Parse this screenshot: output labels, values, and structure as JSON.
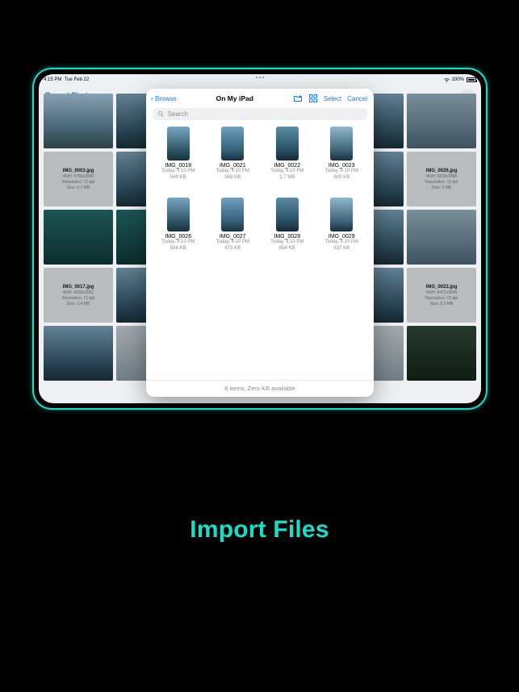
{
  "statusbar": {
    "time": "4:15 PM",
    "date": "Tue Feb 22",
    "battery": "100%"
  },
  "app": {
    "recent_label": "Recent Photos"
  },
  "backdrop": {
    "left_info": {
      "name": "IMG_0003.jpg",
      "wxh": "WxH: 5760x3840",
      "res": "Resolution: 72 dpi",
      "size": "Size: 5.7 MB"
    },
    "left_info2": {
      "name": "IMG_0017.jpg",
      "wxh": "WxH: 4592x3061",
      "res": "Resolution: 72 dpi",
      "size": "Size: 3.4 MB"
    },
    "right_info": {
      "name": "IMG_0026.jpg",
      "wxh": "WxH: 5839x3888",
      "res": "Resolution: 72 dpi",
      "size": "Size: 3 MB"
    },
    "right_info2": {
      "name": "IMG_0022.jpg",
      "wxh": "WxH: 5472x3648",
      "res": "Resolution: 72 dpi",
      "size": "Size: 6.5 MB"
    }
  },
  "picker": {
    "back_label": "Browse",
    "title": "On My iPad",
    "select_label": "Select",
    "cancel_label": "Cancel",
    "search_placeholder": "Search",
    "footer": "8 items, Zero KB available",
    "files": [
      {
        "name": "IMG_0018",
        "date": "Today, 4:10 PM",
        "size": "949 KB"
      },
      {
        "name": "IMG_0021",
        "date": "Today, 4:10 PM",
        "size": "568 KB"
      },
      {
        "name": "IMG_0022",
        "date": "Today, 4:10 PM",
        "size": "1.7 MB"
      },
      {
        "name": "IMG_0023",
        "date": "Today, 4:10 PM",
        "size": "603 KB"
      },
      {
        "name": "IMG_0026",
        "date": "Today, 4:10 PM",
        "size": "566 KB"
      },
      {
        "name": "IMG_0027",
        "date": "Today, 4:10 PM",
        "size": "673 KB"
      },
      {
        "name": "IMG_0028",
        "date": "Today, 4:10 PM",
        "size": "654 KB"
      },
      {
        "name": "IMG_0029",
        "date": "Today, 4:10 PM",
        "size": "637 KB"
      }
    ]
  },
  "caption": "Import Files",
  "colors": {
    "accent": "#13e0c8",
    "ios_blue": "#0a7aff"
  }
}
